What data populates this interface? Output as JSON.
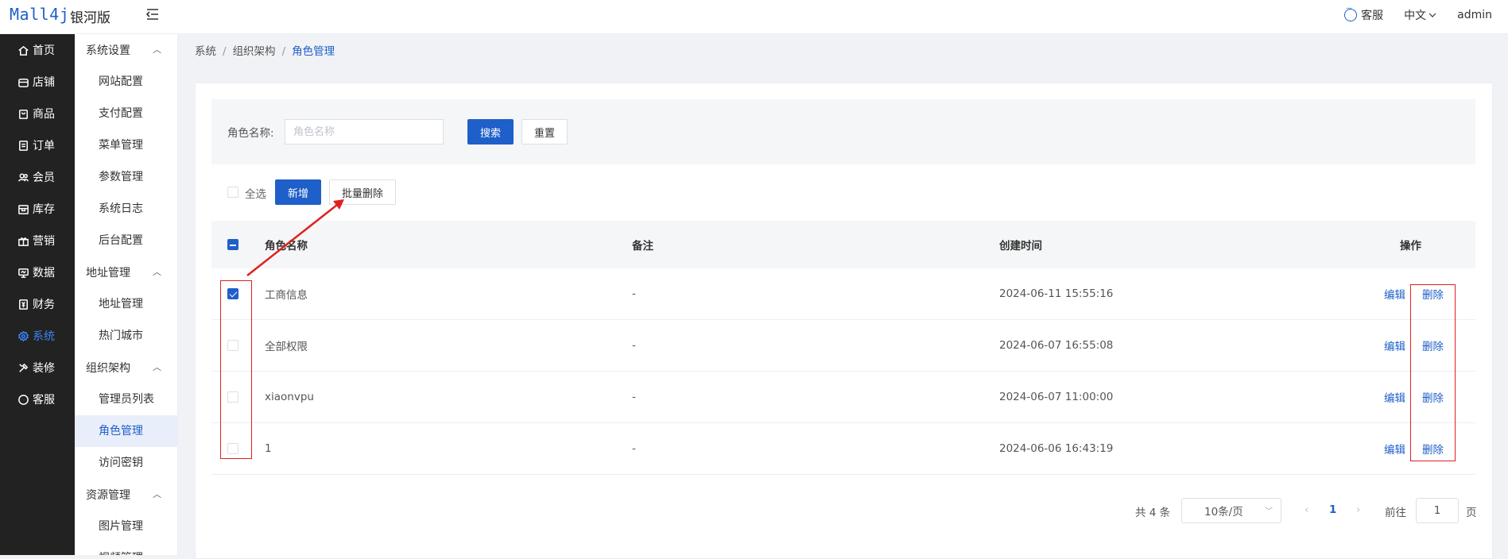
{
  "header": {
    "logo": "Mall4j",
    "edition": "银河版",
    "support": "客服",
    "language": "中文",
    "user": "admin"
  },
  "primary_nav": [
    {
      "label": "首页",
      "icon": "home-icon"
    },
    {
      "label": "店铺",
      "icon": "shop-icon"
    },
    {
      "label": "商品",
      "icon": "goods-icon"
    },
    {
      "label": "订单",
      "icon": "order-icon"
    },
    {
      "label": "会员",
      "icon": "member-icon"
    },
    {
      "label": "库存",
      "icon": "stock-icon"
    },
    {
      "label": "营销",
      "icon": "gift-icon"
    },
    {
      "label": "数据",
      "icon": "data-icon"
    },
    {
      "label": "财务",
      "icon": "finance-icon"
    },
    {
      "label": "系统",
      "icon": "gear-icon",
      "active": true
    },
    {
      "label": "装修",
      "icon": "decorate-icon"
    },
    {
      "label": "客服",
      "icon": "chat-icon"
    }
  ],
  "secondary_nav": {
    "g1": "系统设置",
    "g1_items": [
      "网站配置",
      "支付配置",
      "菜单管理",
      "参数管理",
      "系统日志",
      "后台配置"
    ],
    "g2": "地址管理",
    "g2_items": [
      "地址管理",
      "热门城市"
    ],
    "g3": "组织架构",
    "g3_items": [
      "管理员列表",
      "角色管理",
      "访问密钥"
    ],
    "g4": "资源管理",
    "g4_items": [
      "图片管理",
      "视频管理"
    ]
  },
  "breadcrumb": {
    "a": "系统",
    "b": "组织架构",
    "c": "角色管理"
  },
  "search": {
    "label": "角色名称:",
    "placeholder": "角色名称",
    "search_btn": "搜索",
    "reset_btn": "重置"
  },
  "toolbar": {
    "select_all": "全选",
    "add_btn": "新增",
    "batch_delete_btn": "批量删除"
  },
  "table": {
    "headers": {
      "name": "角色名称",
      "remark": "备注",
      "created": "创建时间",
      "ops": "操作"
    },
    "rows": [
      {
        "name": "工商信息",
        "remark": "-",
        "created": "2024-06-11 15:55:16",
        "checked": true
      },
      {
        "name": "全部权限",
        "remark": "-",
        "created": "2024-06-07 16:55:08",
        "checked": false
      },
      {
        "name": "xiaonvpu",
        "remark": "-",
        "created": "2024-06-07 11:00:00",
        "checked": false
      },
      {
        "name": "1",
        "remark": "-",
        "created": "2024-06-06 16:43:19",
        "checked": false
      }
    ],
    "edit": "编辑",
    "delete": "删除"
  },
  "pagination": {
    "total": "共 4 条",
    "page_size": "10条/页",
    "current": "1",
    "goto_label": "前往",
    "goto_value": "1",
    "page_unit": "页"
  },
  "colors": {
    "accent": "#1f5fc9",
    "sidebar_bg": "#222222",
    "annotation": "#e02020"
  }
}
